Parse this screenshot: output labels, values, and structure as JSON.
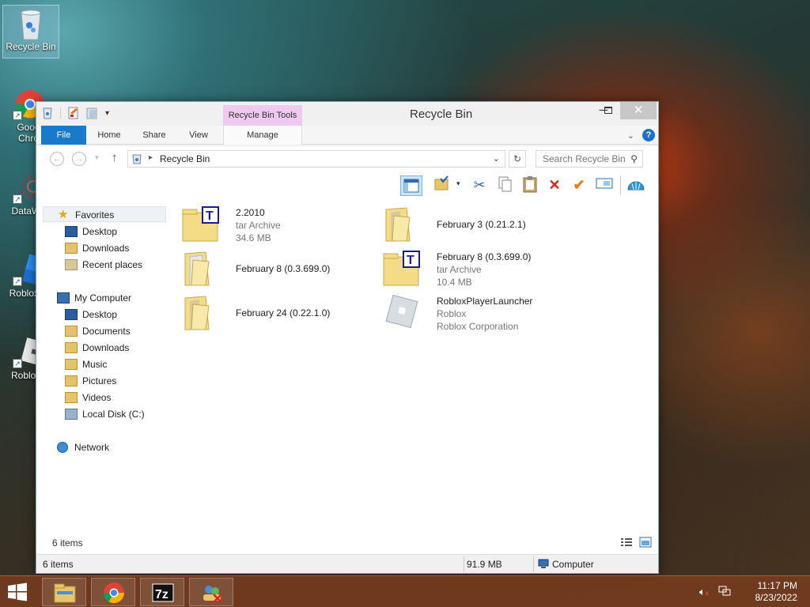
{
  "desktop": {
    "icons": [
      {
        "label": "Recycle Bin"
      },
      {
        "label": "Goog Chro"
      },
      {
        "label": "DataWa"
      },
      {
        "label": "Roblox S"
      },
      {
        "label": "Roblox I"
      }
    ]
  },
  "window": {
    "title": "Recycle Bin",
    "contextual_tab_group": "Recycle Bin Tools",
    "tabs": [
      "File",
      "Home",
      "Share",
      "View",
      "Manage"
    ],
    "address": {
      "crumb": "Recycle Bin"
    },
    "search": {
      "placeholder": "Search Recycle Bin"
    },
    "nav": {
      "favorites": "Favorites",
      "fav_items": [
        "Desktop",
        "Downloads",
        "Recent places"
      ],
      "computer": "My Computer",
      "computer_items": [
        "Desktop",
        "Documents",
        "Downloads",
        "Music",
        "Pictures",
        "Videos",
        "Local Disk (C:)"
      ],
      "network": "Network"
    },
    "files": [
      {
        "name": "2.2010",
        "type": "tar Archive",
        "size": "34.6 MB",
        "icon": "tar-archive-icon"
      },
      {
        "name": "February 3 (0.21.2.1)",
        "icon": "folder-icon"
      },
      {
        "name": "February 8 (0.3.699.0)",
        "icon": "folder-icon"
      },
      {
        "name": "February 8 (0.3.699.0)",
        "type": "tar Archive",
        "size": "10.4 MB",
        "icon": "tar-archive-icon"
      },
      {
        "name": "February 24 (0.22.1.0)",
        "icon": "folder-icon"
      },
      {
        "name": "RobloxPlayerLauncher",
        "type": "Roblox",
        "size": "Roblox Corporation",
        "icon": "roblox-icon"
      }
    ],
    "item_count": "6 items",
    "status": {
      "items": "6 items",
      "size": "91.9 MB",
      "location": "Computer"
    }
  },
  "taskbar": {
    "time": "11:17 PM",
    "date": "8/23/2022"
  },
  "colors": {
    "file_tab": "#1979ca",
    "contextual_tab": "#efc9ef",
    "taskbar": "#7a3c1e"
  }
}
